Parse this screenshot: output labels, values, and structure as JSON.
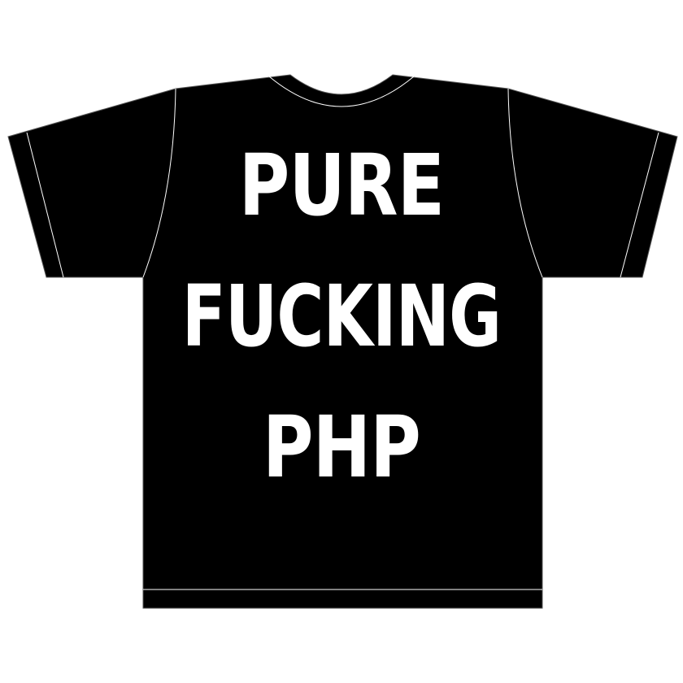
{
  "shirt": {
    "color": "#000000",
    "seam_color": "#ffffff",
    "background": "#ffffff"
  },
  "print": {
    "color": "#ffffff",
    "lines": [
      "PURE",
      "FUCKING",
      "PHP"
    ]
  }
}
